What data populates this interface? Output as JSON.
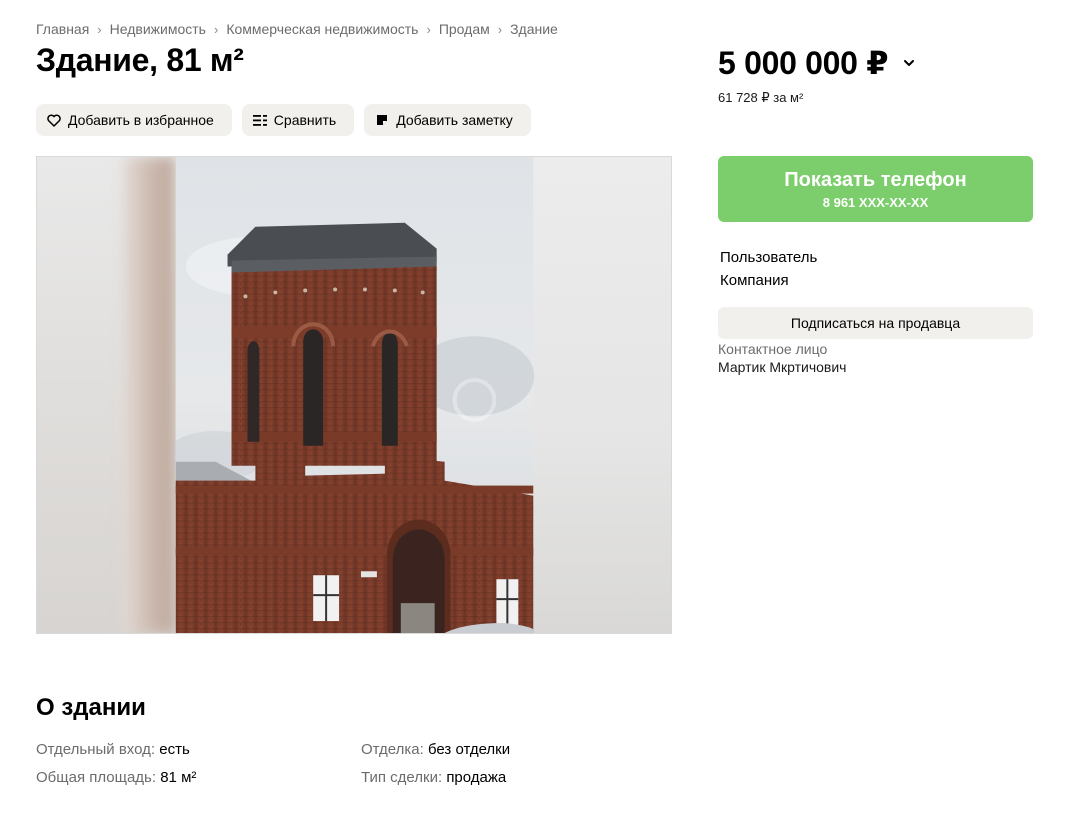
{
  "breadcrumb": [
    "Главная",
    "Недвижимость",
    "Коммерческая недвижимость",
    "Продам",
    "Здание"
  ],
  "title": "Здание, 81 м²",
  "actions": {
    "favorite": "Добавить в избранное",
    "compare": "Сравнить",
    "note": "Добавить заметку"
  },
  "price": {
    "value": "5 000 000 ₽",
    "per_meter": "61 728 ₽ за м²"
  },
  "phone_button": {
    "label": "Показать телефон",
    "masked": "8 961 XXX-XX-XX",
    "color": "#7ccd6c"
  },
  "seller": {
    "name": "Пользователь",
    "type": "Компания",
    "subscribe": "Подписаться на продавца",
    "contact_label": "Контактное лицо",
    "contact_name": "Мартик Мкртичович"
  },
  "about": {
    "title": "О здании",
    "props": [
      {
        "key": "Отдельный вход:",
        "value": "есть"
      },
      {
        "key": "Общая площадь:",
        "value": "81 м²"
      },
      {
        "key": "Отделка:",
        "value": "без отделки"
      },
      {
        "key": "Тип сделки:",
        "value": "продажа"
      }
    ]
  },
  "icons": {
    "favorite": "heart-icon",
    "compare": "compare-icon",
    "note": "note-icon",
    "price_toggle": "chevron-down-icon"
  }
}
